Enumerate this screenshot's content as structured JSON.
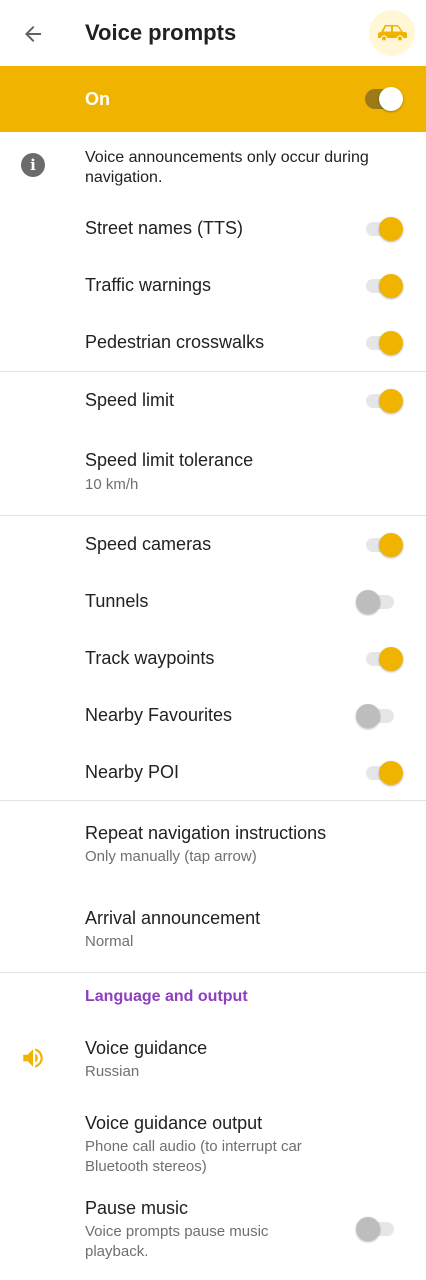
{
  "appbar": {
    "title": "Voice prompts",
    "back_icon": "arrow-left-icon",
    "profile_icon": "car-icon"
  },
  "banner": {
    "label": "On",
    "switch_on": true,
    "color": "#f0b400"
  },
  "info": {
    "text": "Voice announcements only occur during navigation.",
    "icon": "info-icon"
  },
  "items": {
    "street_names": {
      "label": "Street names (TTS)",
      "on": true
    },
    "traffic_warnings": {
      "label": "Traffic warnings",
      "on": true
    },
    "pedestrian_crosswalks": {
      "label": "Pedestrian crosswalks",
      "on": true
    },
    "speed_limit": {
      "label": "Speed limit",
      "on": true
    },
    "speed_limit_tolerance": {
      "label": "Speed limit tolerance",
      "value": "10 km/h"
    },
    "speed_cameras": {
      "label": "Speed cameras",
      "on": true
    },
    "tunnels": {
      "label": "Tunnels",
      "on": false
    },
    "track_waypoints": {
      "label": "Track waypoints",
      "on": true
    },
    "nearby_favourites": {
      "label": "Nearby Favourites",
      "on": false
    },
    "nearby_poi": {
      "label": "Nearby POI",
      "on": true
    },
    "repeat_navigation": {
      "label": "Repeat navigation instructions",
      "value": "Only manually (tap arrow)"
    },
    "arrival_announcement": {
      "label": "Arrival announcement",
      "value": "Normal"
    }
  },
  "language_section": {
    "header": "Language and output",
    "voice_guidance": {
      "label": "Voice guidance",
      "value": "Russian",
      "icon": "speaker-icon"
    },
    "voice_guidance_output": {
      "label": "Voice guidance output",
      "value_line1": "Phone call audio (to interrupt car",
      "value_line2": "Bluetooth stereos)"
    },
    "pause_music": {
      "label": "Pause music",
      "desc_line1": "Voice prompts pause music",
      "desc_line2": "playback.",
      "on": false
    }
  },
  "colors": {
    "accent": "#f0b400",
    "section_header": "#8e3ec0",
    "divider": "#e2e2e2"
  }
}
